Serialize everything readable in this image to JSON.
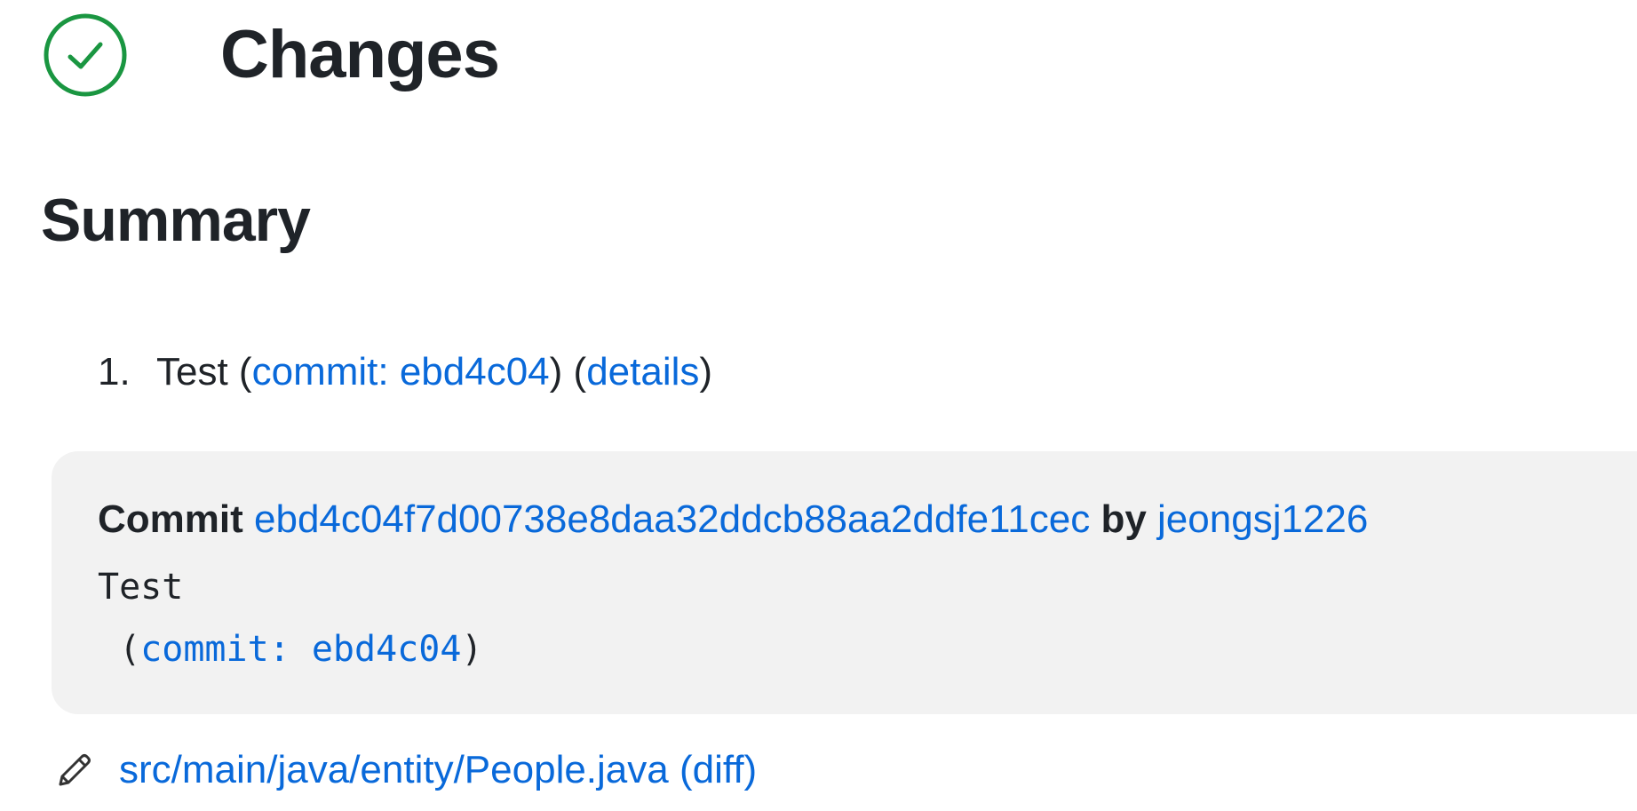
{
  "header": {
    "status_icon": "check-circle-icon",
    "status_color": "#1a9641",
    "title": "Changes"
  },
  "summary": {
    "heading": "Summary",
    "items": [
      {
        "number": "1.",
        "message": "Test",
        "open_paren_1": " (",
        "commit_link": "commit: ebd4c04",
        "between": ") (",
        "details_link": "details",
        "close_paren": ")"
      }
    ]
  },
  "commit": {
    "label": "Commit",
    "hash": "ebd4c04f7d00738e8daa32ddcb88aa2ddfe11cec",
    "by_label": "by",
    "author": "jeongsj1226",
    "message_line": "Test",
    "ref_open": " (",
    "ref_link": "commit: ebd4c04",
    "ref_close": ")"
  },
  "files": [
    {
      "icon": "pencil-icon",
      "path": "src/main/java/entity/People.java",
      "diff_label": "(diff)"
    }
  ],
  "colors": {
    "link": "#0969da",
    "text": "#1f2328",
    "box_bg": "#f2f2f2"
  }
}
